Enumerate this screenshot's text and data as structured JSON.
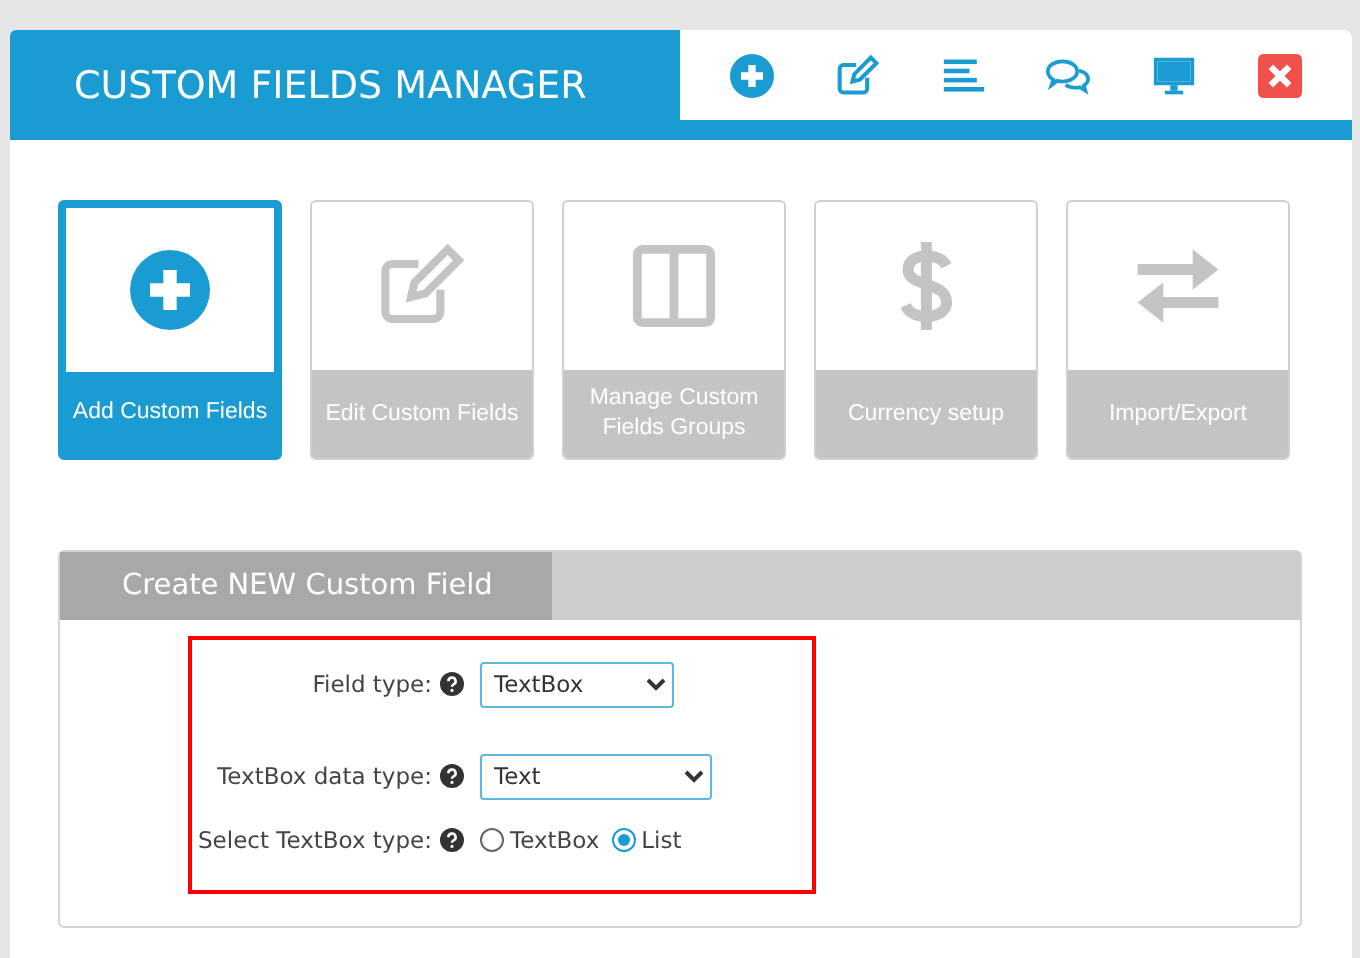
{
  "header": {
    "title": "CUSTOM FIELDS MANAGER"
  },
  "toolbar": [
    {
      "kind": "add"
    },
    {
      "kind": "edit"
    },
    {
      "kind": "list"
    },
    {
      "kind": "chat"
    },
    {
      "kind": "monitor"
    },
    {
      "kind": "close"
    }
  ],
  "tiles": [
    {
      "label": "Add Custom Fields",
      "kind": "add",
      "selected": true
    },
    {
      "label": "Edit Custom Fields",
      "kind": "edit",
      "selected": false
    },
    {
      "label": "Manage Custom Fields Groups",
      "kind": "columns",
      "selected": false
    },
    {
      "label": "Currency setup",
      "kind": "dollar",
      "selected": false
    },
    {
      "label": "Import/Export",
      "kind": "arrows",
      "selected": false
    }
  ],
  "panel": {
    "tab": "Create NEW Custom Field",
    "rows": [
      {
        "kind": "select",
        "label": "Field type:",
        "value": "TextBox"
      },
      {
        "kind": "select",
        "label": "TextBox data type:",
        "value": "Text"
      },
      {
        "kind": "radio",
        "label": "Select TextBox type:",
        "options": [
          {
            "label": "TextBox",
            "selected": false
          },
          {
            "label": "List",
            "selected": true
          }
        ]
      }
    ]
  }
}
